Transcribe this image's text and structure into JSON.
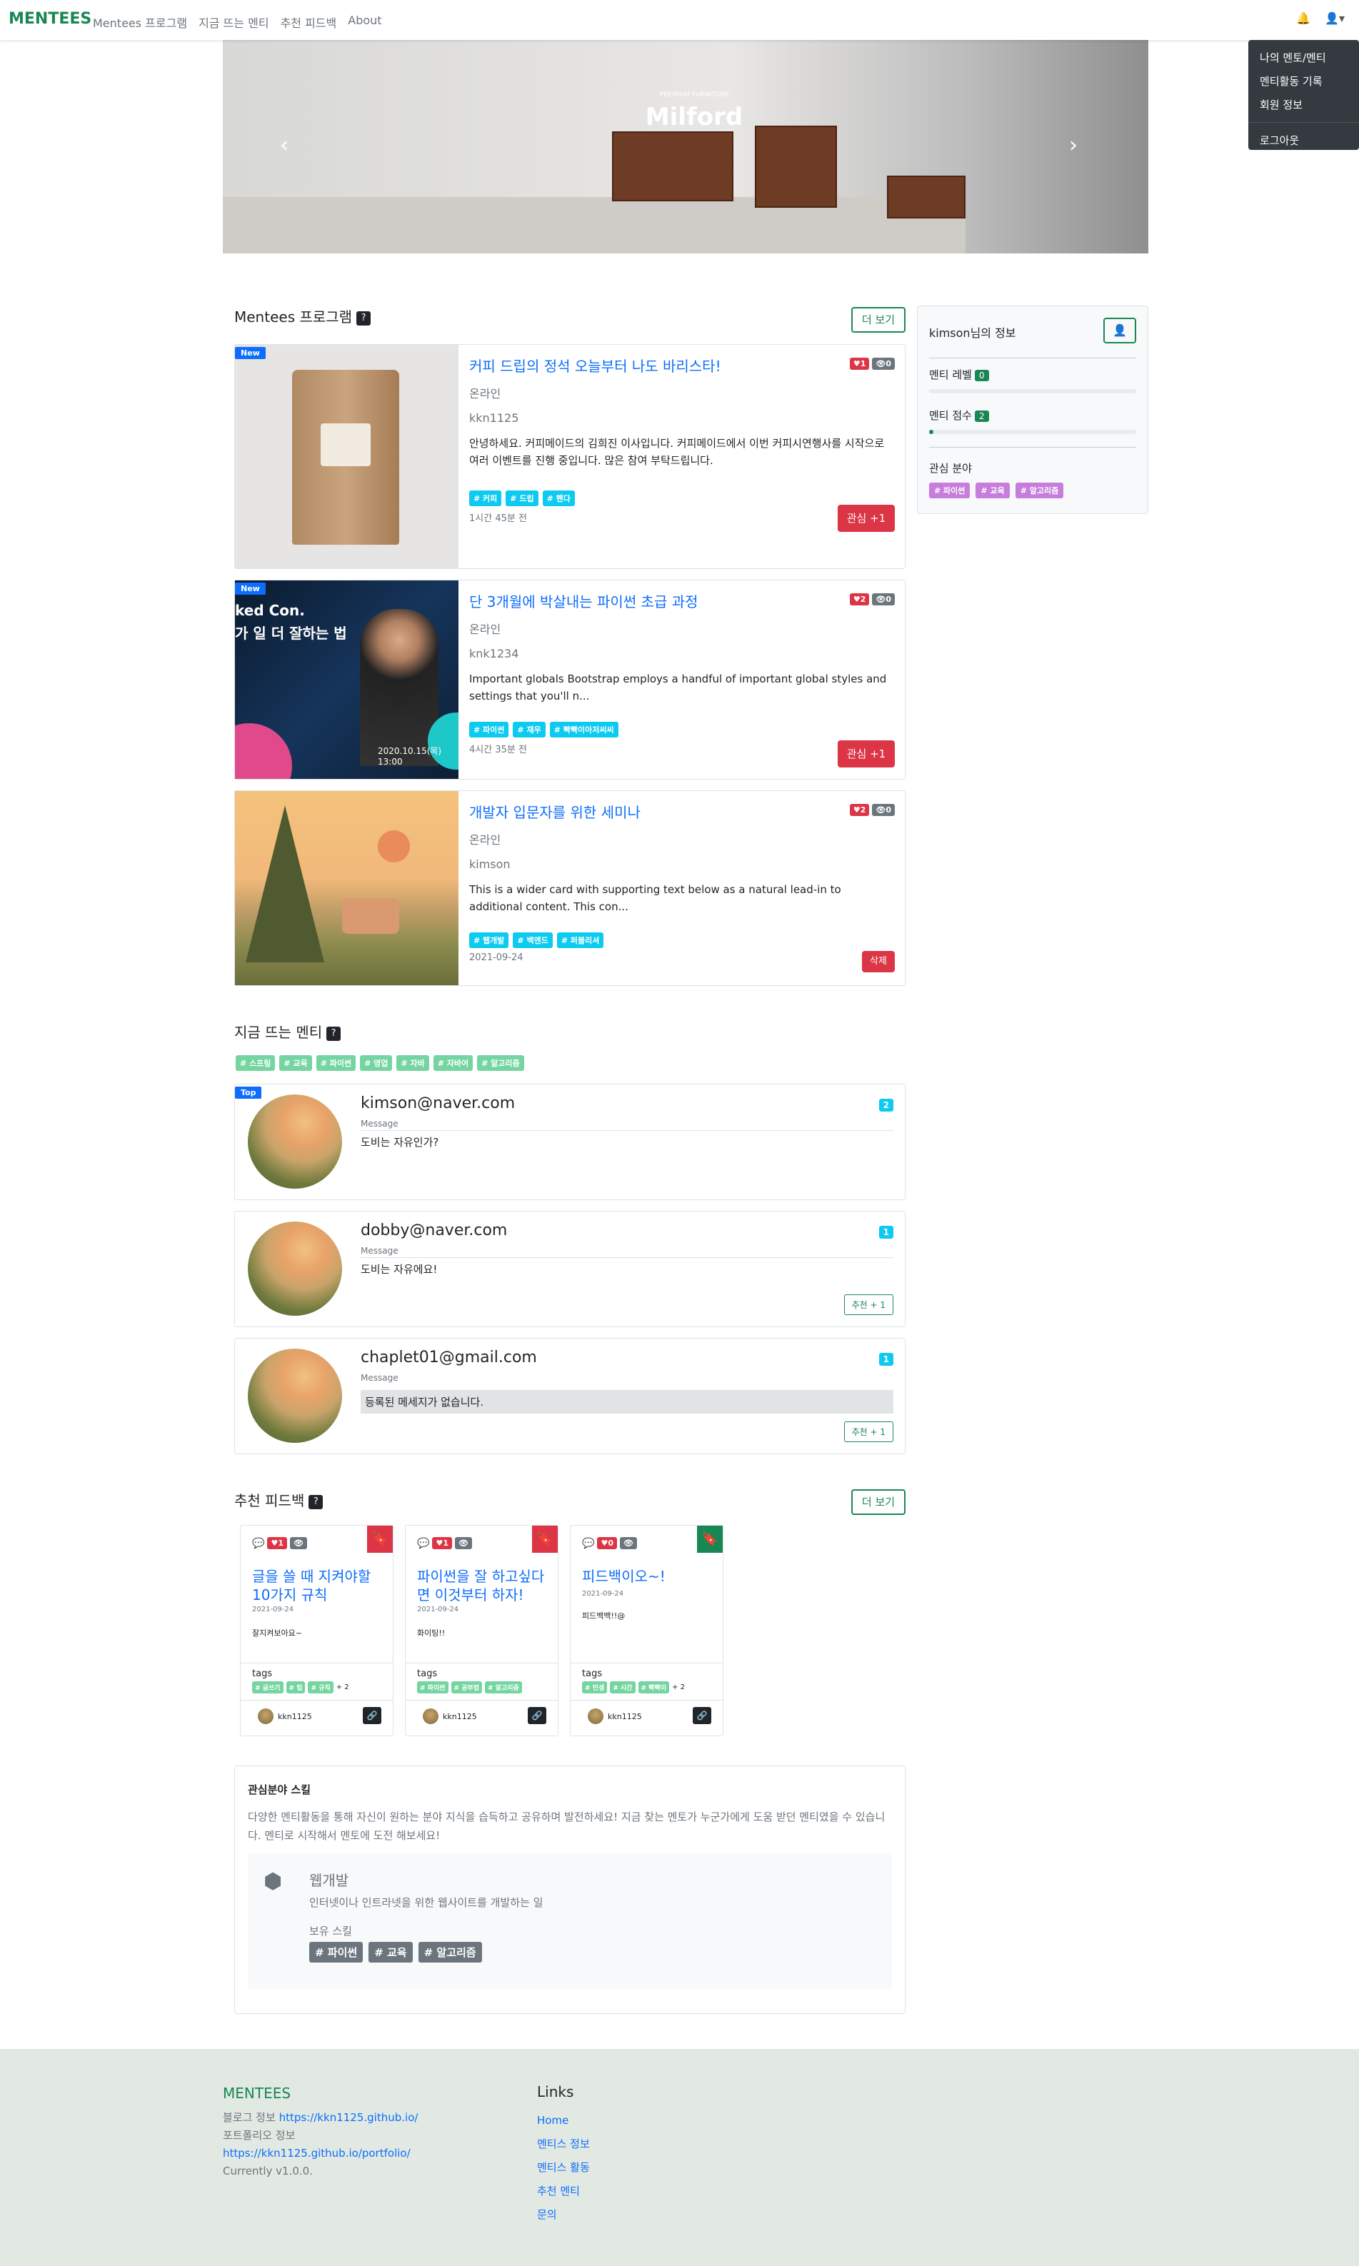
{
  "nav": {
    "brand": "MENTEES",
    "links": [
      "Mentees 프로그램",
      "지금 뜨는 멘티",
      "추천 피드백",
      "About"
    ],
    "dropdown": [
      "나의 멘토/멘티",
      "멘티활동 기록",
      "회원 정보",
      "로그아웃"
    ]
  },
  "banner": {
    "title": "Milford",
    "subtitle": "PREMIUM FURNITURE",
    "caption": ""
  },
  "programs": {
    "title": "Mentees 프로그램",
    "help": "?",
    "more": "더 보기",
    "cards": [
      {
        "badge": "New",
        "title": "커피 드립의 정석 오늘부터 나도 바리스타!",
        "likes": "1",
        "views": "0",
        "mode": "온라인",
        "author": "kkn1125",
        "desc": "안녕하세요. 커피메이드의 김희진 이사입니다. 커피메이드에서 이번 커피시연행사를 시작으로 여러 이벤트를 진행 중입니다. 많은 참여 부탁드립니다.",
        "tags": [
          "# 커피",
          "# 드립",
          "# 핸다"
        ],
        "time": "1시간 45분 전",
        "action": "관심 +1"
      },
      {
        "badge": "New",
        "title": "단 3개월에 박살내는 파이썬 초급 과정",
        "likes": "2",
        "views": "0",
        "mode": "온라인",
        "author": "knk1234",
        "desc": "Important globals Bootstrap employs a handful of important global styles and settings that you'll n...",
        "tags": [
          "# 파이썬",
          "# 재우",
          "# 빡빡이아저씨씨"
        ],
        "time": "4시간 35분 전",
        "action": "관심 +1",
        "img_text": [
          "ked Con.",
          "가 일 더 잘하는 법",
          "2020.10.15(목) 13:00"
        ]
      },
      {
        "badge": "",
        "title": "개발자 입문자를 위한 세미나",
        "likes": "2",
        "views": "0",
        "mode": "온라인",
        "author": "kimson",
        "desc": "This is a wider card with supporting text below as a natural lead-in to additional content. This con...",
        "tags": [
          "# 웹개발",
          "# 백엔드",
          "# 퍼블리셔"
        ],
        "time": "2021-09-24",
        "action": "삭제"
      }
    ]
  },
  "sidebar": {
    "name": "kimson님의 정보",
    "level_label": "멘티 레벨",
    "level": "0",
    "level_progress": 0,
    "score_label": "멘티 점수",
    "score": "2",
    "score_progress": 0.02,
    "interest_label": "관심 분야",
    "interests": [
      "# 파이썬",
      "# 교육",
      "# 알고리즘"
    ]
  },
  "mentees": {
    "title": "지금 뜨는 멘티",
    "help": "?",
    "filter_tags": [
      "# 스프링",
      "# 교육",
      "# 파이썬",
      "# 영업",
      "# 자바",
      "# 자바어",
      "# 알고리즘"
    ],
    "cards": [
      {
        "badge": "Top",
        "email": "kimson@naver.com",
        "label": "Message",
        "message": "도비는 자유인가?",
        "count": "2",
        "action": ""
      },
      {
        "badge": "",
        "email": "dobby@naver.com",
        "label": "Message",
        "message": "도비는 자유에요!",
        "count": "1",
        "action": "추천 + 1"
      },
      {
        "badge": "",
        "email": "chaplet01@gmail.com",
        "label": "Message",
        "message": "등록된 메세지가 없습니다.",
        "count": "1",
        "action": "추천 + 1"
      }
    ]
  },
  "feedback": {
    "title": "추천 피드백",
    "help": "?",
    "more": "더 보기",
    "cards": [
      {
        "title": "글을 쓸 때 지켜야할 10가지 규칙",
        "likes": "1",
        "date": "2021-09-24",
        "body": "잘지켜보아요~",
        "tag_label": "tags",
        "tags": [
          "# 글쓰기",
          "# 팁",
          "# 규칙"
        ],
        "more": "+ 2",
        "author": "kkn1125",
        "bookmark_color": "#dc3545"
      },
      {
        "title": "파이썬을 잘 하고싶다면 이것부터 하자!",
        "likes": "1",
        "date": "2021-09-24",
        "body": "화이팅!!",
        "tag_label": "tags",
        "tags": [
          "# 파이썬",
          "# 공부법",
          "# 알고리즘"
        ],
        "more": "",
        "author": "kkn1125",
        "bookmark_color": "#dc3545"
      },
      {
        "title": "피드백이오~!",
        "likes": "0",
        "date": "2021-09-24",
        "body": "피드백백!!@",
        "tag_label": "tags",
        "tags": [
          "# 인생",
          "# 시간",
          "# 빡빡이"
        ],
        "more": "+ 2",
        "author": "kkn1125",
        "bookmark_color": "#198754"
      }
    ]
  },
  "skill": {
    "title": "관심분야 스킬",
    "desc": "다양한 멘티활동을 통해 자신이 원하는 분야 지식을 습득하고 공유하며 발전하세요! 지금 찾는 멘토가 누군가에게 도움 받던 멘티였을 수 있습니다. 멘티로 시작해서 멘토에 도전 해보세요!",
    "name": "웹개발",
    "sdesc": "인터넷이나 인트라넷을 위한 웹사이트를 개발하는 일",
    "have_label": "보유 스킬",
    "tags": [
      "# 파이썬",
      "# 교육",
      "# 알고리즘"
    ]
  },
  "footer": {
    "brand": "MENTEES",
    "blog_label": "블로그 정보",
    "blog_url": "https://kkn1125.github.io/",
    "portfolio_label": "포트폴리오 정보",
    "portfolio_url": "https://kkn1125.github.io/portfolio/",
    "version": "Currently v1.0.0.",
    "links_title": "Links",
    "links": [
      "Home",
      "멘티스 정보",
      "멘티스 활동",
      "추천 멘티",
      "문의"
    ]
  }
}
